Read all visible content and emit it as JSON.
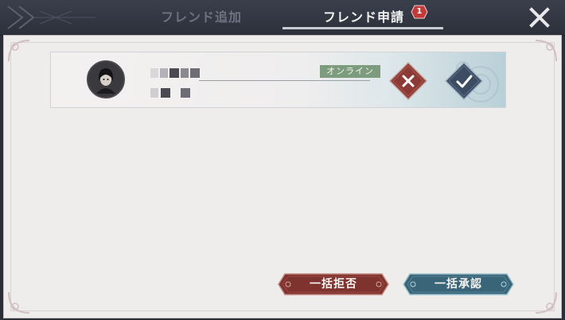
{
  "tabs": {
    "add_friend": "フレンド追加",
    "friend_requests": "フレンド申請",
    "request_badge": "1"
  },
  "request_card": {
    "status": "オンライン"
  },
  "actions": {
    "bulk_reject": "一括拒否",
    "bulk_accept": "一括承認"
  },
  "colors": {
    "reject": "#8c3a35",
    "accept": "#3b6478",
    "online": "#7d9b7d"
  }
}
